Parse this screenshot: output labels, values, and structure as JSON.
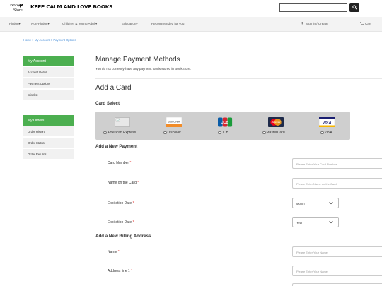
{
  "header": {
    "logo_top": "Book",
    "logo_bottom": "Store",
    "tagline": "KEEP CALM AND LOVE BOOKS",
    "search": {
      "value": "",
      "placeholder": ""
    }
  },
  "nav": {
    "items": [
      "Fiction▾",
      "Non-Fiction▾",
      "Children & Young Adult▾",
      "Education▾",
      "Recommended for you"
    ],
    "signin": "Sign in / Create",
    "cart": "Cart"
  },
  "breadcrumb": "Home > My Account > Payment Options",
  "sidebar": {
    "account_title": "My Account",
    "account_items": [
      "Account Detail",
      "Payment Options",
      "Wishlist"
    ],
    "orders_title": "My Orders",
    "orders_items": [
      "Order History",
      "Order Status",
      "Order Returns"
    ]
  },
  "main": {
    "title": "Manage Payment Methods",
    "note": "You do not currently have any payment cards stored in BookStore.",
    "add_card_title": "Add a Card",
    "card_select_title": "Card Select",
    "cards": [
      {
        "label": "American Express",
        "icon": "broken-image-icon",
        "badge": ""
      },
      {
        "label": "Discover",
        "icon": "discover-logo",
        "badge": "DISCOVER"
      },
      {
        "label": "JCB",
        "icon": "jcb-logo",
        "badge": "JCB"
      },
      {
        "label": "MasterCard",
        "icon": "mastercard-logo",
        "badge": "MasterCard"
      },
      {
        "label": "VISA",
        "icon": "visa-logo",
        "badge": "VISA"
      }
    ],
    "new_payment_title": "Add a New Payment",
    "payment_fields": [
      {
        "label": "Card Number",
        "placeholder": "Please Enter Your Card Number"
      },
      {
        "label": "Name on the Card",
        "placeholder": "Please Enter Name on the Card"
      }
    ],
    "expiration_month": {
      "label": "Expiration Date",
      "value": "Month"
    },
    "expiration_year": {
      "label": "Expiration Date",
      "value": "Year"
    },
    "billing_title": "Add a New Billing Address",
    "billing_fields": [
      {
        "label": "Name",
        "placeholder": "Please Enter Your Name"
      },
      {
        "label": "Address line 1",
        "placeholder": "Please Enter Your Name"
      }
    ],
    "required_mark": "*"
  },
  "colors": {
    "accent_green": "#4caf50",
    "required_red": "#e53935",
    "link_blue": "#4a90d9",
    "card_panel": "#cfcfcf"
  }
}
